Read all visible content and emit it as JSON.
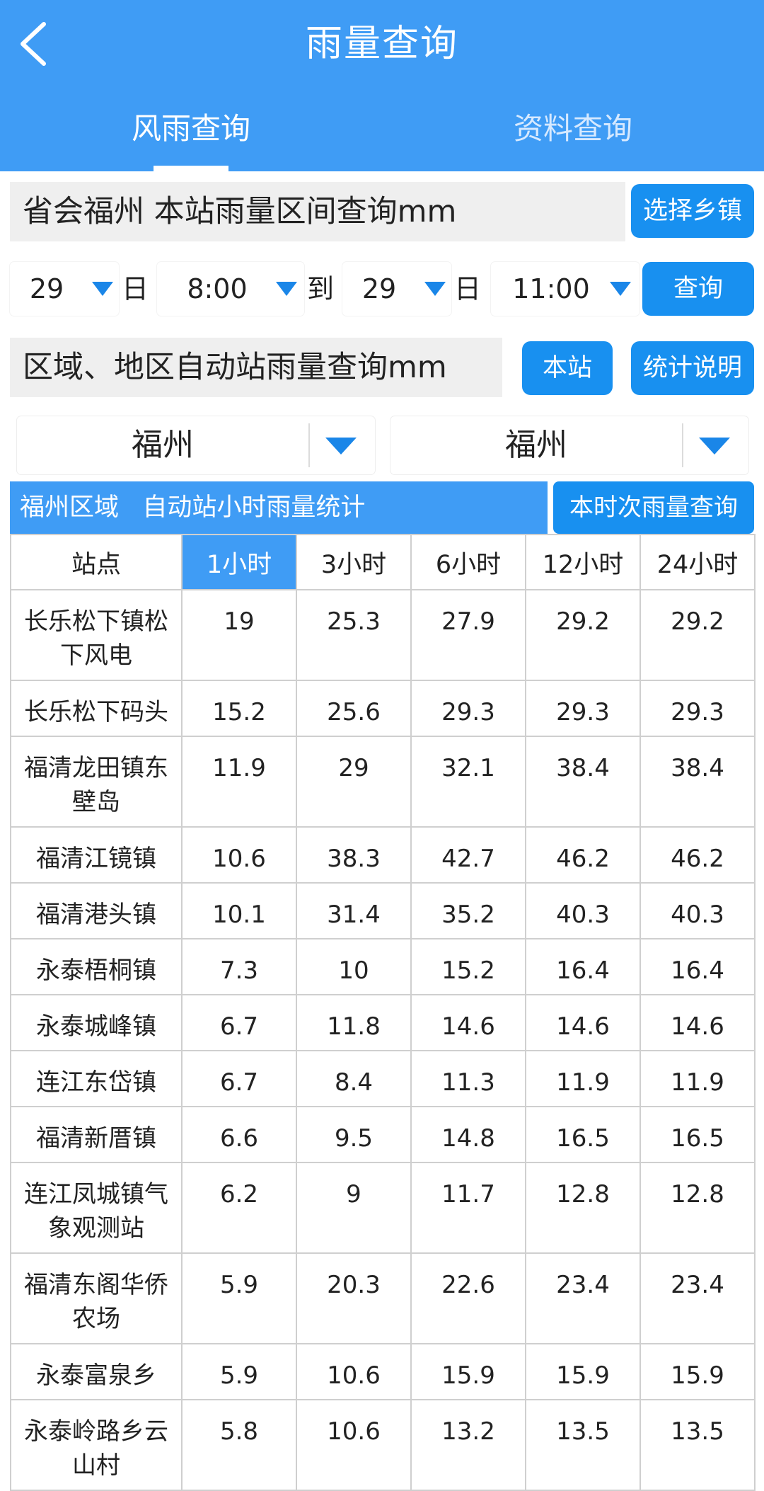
{
  "header": {
    "title": "雨量查询",
    "tabs": [
      {
        "label": "风雨查询",
        "active": true
      },
      {
        "label": "资料查询",
        "active": false
      }
    ]
  },
  "station_query": {
    "label": "省会福州  本站雨量区间查询mm",
    "select_button": "选择乡镇",
    "from_day": "29",
    "day_unit": "日",
    "from_time": "8:00",
    "to_label": "到",
    "to_day": "29",
    "to_time": "11:00",
    "query_button": "查询"
  },
  "region_query": {
    "label": "区域、地区自动站雨量查询mm",
    "this_station_button": "本站",
    "stats_info_button": "统计说明",
    "region_a": "福州",
    "region_b": "福州"
  },
  "stats": {
    "title": "福州区域   自动站小时雨量统计",
    "hourly_query_button": "本时次雨量查询"
  },
  "table": {
    "headers": [
      "站点",
      "1小时",
      "3小时",
      "6小时",
      "12小时",
      "24小时"
    ],
    "active_column": 1,
    "rows": [
      {
        "name": "长乐松下镇松下风电",
        "values": [
          "19",
          "25.3",
          "27.9",
          "29.2",
          "29.2"
        ]
      },
      {
        "name": "长乐松下码头",
        "values": [
          "15.2",
          "25.6",
          "29.3",
          "29.3",
          "29.3"
        ]
      },
      {
        "name": "福清龙田镇东壁岛",
        "values": [
          "11.9",
          "29",
          "32.1",
          "38.4",
          "38.4"
        ]
      },
      {
        "name": "福清江镜镇",
        "values": [
          "10.6",
          "38.3",
          "42.7",
          "46.2",
          "46.2"
        ]
      },
      {
        "name": "福清港头镇",
        "values": [
          "10.1",
          "31.4",
          "35.2",
          "40.3",
          "40.3"
        ]
      },
      {
        "name": "永泰梧桐镇",
        "values": [
          "7.3",
          "10",
          "15.2",
          "16.4",
          "16.4"
        ]
      },
      {
        "name": "永泰城峰镇",
        "values": [
          "6.7",
          "11.8",
          "14.6",
          "14.6",
          "14.6"
        ]
      },
      {
        "name": "连江东岱镇",
        "values": [
          "6.7",
          "8.4",
          "11.3",
          "11.9",
          "11.9"
        ]
      },
      {
        "name": "福清新厝镇",
        "values": [
          "6.6",
          "9.5",
          "14.8",
          "16.5",
          "16.5"
        ]
      },
      {
        "name": "连江凤城镇气象观测站",
        "values": [
          "6.2",
          "9",
          "11.7",
          "12.8",
          "12.8"
        ]
      },
      {
        "name": "福清东阁华侨农场",
        "values": [
          "5.9",
          "20.3",
          "22.6",
          "23.4",
          "23.4"
        ]
      },
      {
        "name": "永泰富泉乡",
        "values": [
          "5.9",
          "10.6",
          "15.9",
          "15.9",
          "15.9"
        ]
      },
      {
        "name": "永泰岭路乡云山村",
        "values": [
          "5.8",
          "10.6",
          "13.2",
          "13.5",
          "13.5"
        ]
      }
    ]
  },
  "colors": {
    "header_bg": "#3f9cf5",
    "button_bg": "#1890f0",
    "arrow": "#1a86e8"
  }
}
